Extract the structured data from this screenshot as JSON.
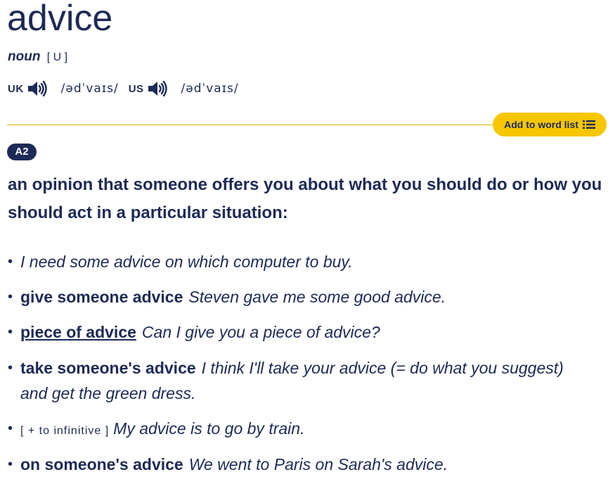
{
  "entry": {
    "headword": "advice",
    "pos": "noun",
    "grammar": "[ U ]",
    "pron": {
      "uk_label": "UK",
      "uk_ipa": "/ədˈvaɪs/",
      "us_label": "US",
      "us_ipa": "/ədˈvaɪs/"
    },
    "add_to_word_list": "Add to word list",
    "level": "A2",
    "definition": "an opinion that someone offers you about what you should do or how you should act in a particular situation:",
    "examples": [
      {
        "bullet": "•",
        "lu": "",
        "gram": "",
        "text": "I need some advice on which computer to buy."
      },
      {
        "bullet": "•",
        "lu": "give someone advice",
        "gram": "",
        "text": "Steven gave me some good advice."
      },
      {
        "bullet": "•",
        "lu": "piece of advice",
        "gram": "",
        "text": "Can I give you a piece of advice?"
      },
      {
        "bullet": "•",
        "lu": "take someone's advice",
        "gram": "",
        "text": "I think I'll take your advice (= do what you suggest) and get the green dress."
      },
      {
        "bullet": "•",
        "lu": "",
        "gram": "[ + to infinitive ]",
        "text": "My advice is to go by train."
      },
      {
        "bullet": "•",
        "lu": "on someone's advice",
        "gram": "",
        "text": "We went to Paris on Sarah's advice."
      }
    ]
  },
  "icons": {
    "uk_audio": "speaker-icon",
    "us_audio": "speaker-icon",
    "word_list": "list-icon"
  },
  "colors": {
    "text": "#1d2a57",
    "accent_button": "#f7c600",
    "rule": "#d9b800",
    "badge": "#1d2a57"
  }
}
